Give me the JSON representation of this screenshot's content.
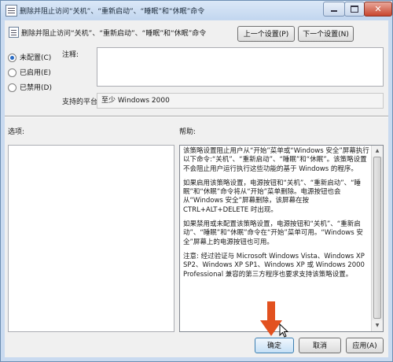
{
  "window": {
    "title": "删除并阻止访问“关机”、“重新启动”、“睡眠”和“休眠”命令",
    "controls": {
      "close_glyph": "✕"
    }
  },
  "header": {
    "policy_name": "删除并阻止访问“关机”、“重新启动”、“睡眠”和“休眠”命令",
    "prev_button": "上一个设置(P)",
    "next_button": "下一个设置(N)"
  },
  "state": {
    "options": [
      {
        "label": "未配置(C)",
        "selected": true
      },
      {
        "label": "已启用(E)",
        "selected": false
      },
      {
        "label": "已禁用(D)",
        "selected": false
      }
    ]
  },
  "comment": {
    "label": "注释:",
    "value": ""
  },
  "platform": {
    "label": "支持的平台:",
    "value": "至少 Windows 2000"
  },
  "options_section": {
    "label": "选项:"
  },
  "help_section": {
    "label": "帮助:",
    "paragraphs": [
      "该策略设置阻止用户从“开始”菜单或“Windows 安全”屏幕执行以下命令:“关机”、“重新启动”、“睡眠”和“休眠”。该策略设置不会阻止用户运行执行这些功能的基于 Windows 的程序。",
      "如果启用该策略设置，电源按钮和“关机”、“重新启动”、“睡眠”和“休眠”命令将从“开始”菜单删除。电源按钮也会从“Windows 安全”屏幕删除，该屏幕在按 CTRL+ALT+DELETE 时出现。",
      "如果禁用或未配置该策略设置，电源按钮和“关机”、“重新启动”、“睡眠”和“休眠”命令在“开始”菜单可用。“Windows 安全”屏幕上的电源按钮也可用。",
      "注意: 经过验证与 Microsoft Windows Vista、Windows XP SP2、Windows XP SP1、Windows XP 或 Windows 2000 Professional 兼容的第三方程序也要求支持该策略设置。"
    ]
  },
  "footer": {
    "ok_button": "确定",
    "cancel_button": "取消",
    "apply_button": "应用(A)"
  },
  "colors": {
    "accent": "#2a6bc4",
    "annotation_arrow": "#e2511f"
  }
}
